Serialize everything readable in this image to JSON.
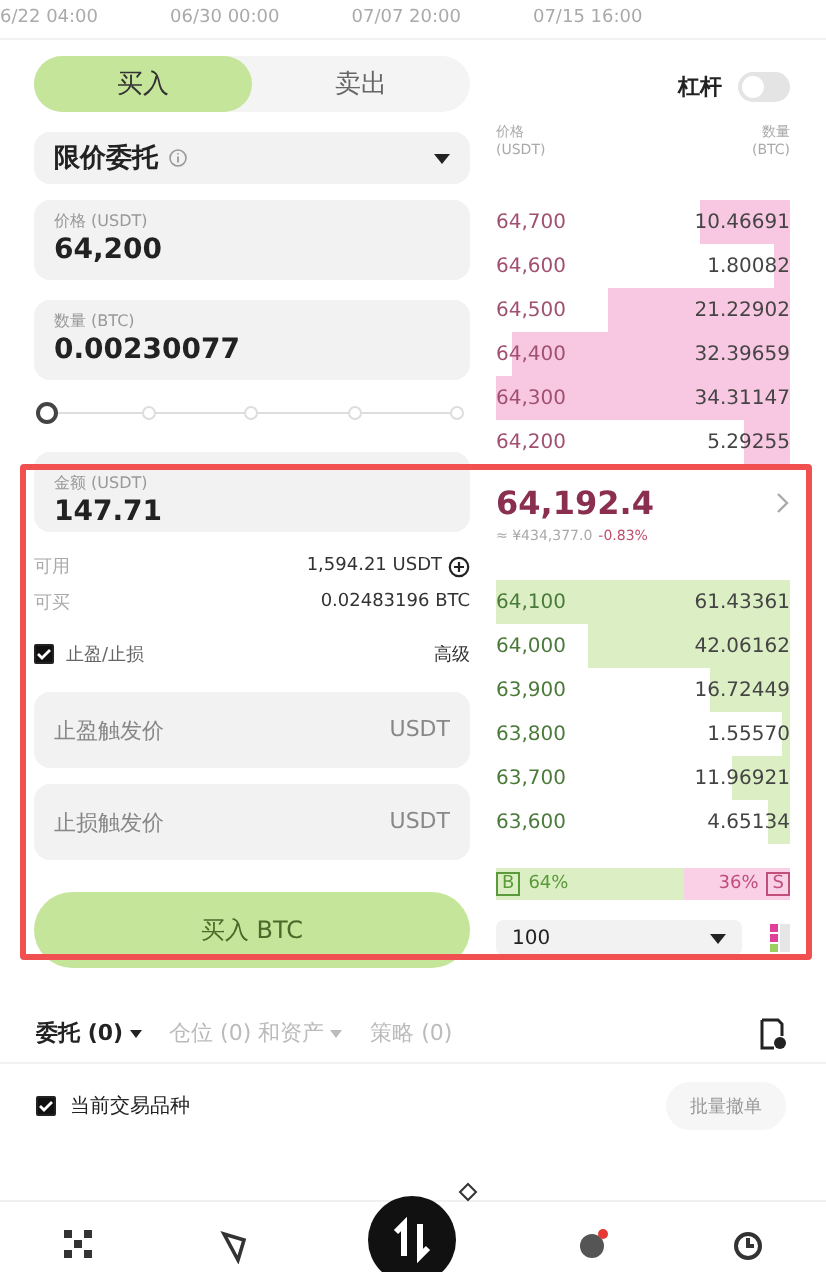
{
  "chart_axis": [
    "6/22 04:00",
    "06/30 00:00",
    "07/07 20:00",
    "07/15 16:00"
  ],
  "side_tabs": [
    {
      "label": "买入",
      "selected": true
    },
    {
      "label": "卖出",
      "selected": false
    }
  ],
  "leverage": {
    "label": "杠杆",
    "on": false
  },
  "order_type": {
    "value": "限价委托"
  },
  "fields": [
    {
      "label": "价格 (USDT)",
      "value": "64,200"
    },
    {
      "label": "数量 (BTC)",
      "value": "0.00230077"
    }
  ],
  "slider": {
    "level": 0
  },
  "amount_field": {
    "label": "金额 (USDT)",
    "value": "147.71"
  },
  "balances": [
    {
      "label": "可用",
      "value": "1,594.21 USDT",
      "icon": true
    },
    {
      "label": "可买",
      "value": "0.02483196 BTC",
      "icon": false
    }
  ],
  "tpsl": {
    "label": "止盈/止损",
    "checked": true,
    "advanced": "高级"
  },
  "trigger_fields": [
    {
      "placeholder": "止盈触发价",
      "unit": "USDT"
    },
    {
      "placeholder": "止损触发价",
      "unit": "USDT"
    }
  ],
  "submit_button": "买入 BTC",
  "book_header": {
    "price": "价格",
    "price_unit": "(USDT)",
    "amount": "数量",
    "amount_unit": "(BTC)"
  },
  "asks": [
    {
      "price": "64,700",
      "amount": "10.46691"
    },
    {
      "price": "64,600",
      "amount": "1.80082"
    },
    {
      "price": "64,500",
      "amount": "21.22902"
    },
    {
      "price": "64,400",
      "amount": "32.39659"
    },
    {
      "price": "64,300",
      "amount": "34.31147"
    },
    {
      "price": "64,200",
      "amount": "5.29255"
    }
  ],
  "last_price": {
    "price": "64,192.4",
    "fiat": "≈ ¥434,377.0",
    "change": "-0.83%"
  },
  "bids": [
    {
      "price": "64,100",
      "amount": "61.43361"
    },
    {
      "price": "64,000",
      "amount": "42.06162"
    },
    {
      "price": "63,900",
      "amount": "16.72449"
    },
    {
      "price": "63,800",
      "amount": "1.55570"
    },
    {
      "price": "63,700",
      "amount": "11.96921"
    },
    {
      "price": "63,600",
      "amount": "4.65134"
    }
  ],
  "ratio": {
    "buy_tag": "B",
    "buy": "64%",
    "sell": "36%",
    "sell_tag": "S",
    "level": 0.64
  },
  "depth_select": {
    "value": "100"
  },
  "order_tabs": [
    {
      "label": "委托 (0)",
      "selected": true,
      "dropdown": true
    },
    {
      "label": "仓位 (0) 和资产",
      "selected": false,
      "dropdown": true
    },
    {
      "label": "策略 (0)",
      "selected": false,
      "dropdown": false
    }
  ],
  "current_symbol": {
    "label": "当前交易品种",
    "checked": true
  },
  "bulk_cancel": {
    "label": "批量撤单",
    "disabled": true
  },
  "nav": [
    {
      "kind": "grid",
      "selected": false,
      "badge": false
    },
    {
      "kind": "compass",
      "selected": false,
      "badge": false
    },
    {
      "kind": "trade",
      "selected": true,
      "badge": false
    },
    {
      "kind": "planet",
      "selected": false,
      "badge": true
    },
    {
      "kind": "clock",
      "selected": false,
      "badge": false
    }
  ]
}
